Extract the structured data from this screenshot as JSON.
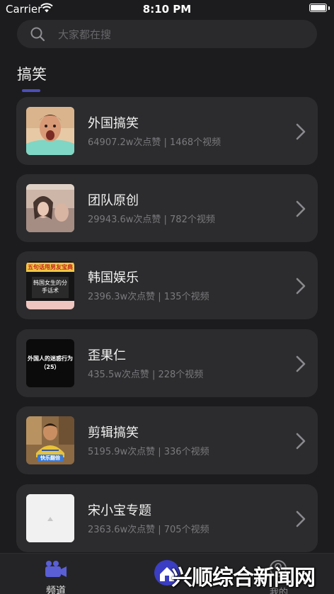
{
  "status": {
    "carrier": "Carrier",
    "time": "8:10 PM"
  },
  "search": {
    "placeholder": "大家都在搜"
  },
  "section": {
    "title": "搞笑"
  },
  "items": [
    {
      "title": "外国搞笑",
      "meta": "64907.2w次点赞 | 1468个视频"
    },
    {
      "title": "团队原创",
      "meta": "29943.6w次点赞 | 782个视频"
    },
    {
      "title": "韩国娱乐",
      "meta": "2396.3w次点赞 | 135个视频",
      "thumb_banner": "五句话甩男友宝典",
      "thumb_caption": "韩国女生的分手话术"
    },
    {
      "title": "歪果仁",
      "meta": "435.5w次点赞 | 228个视频",
      "thumb_caption": "外国人的迷惑行为（25）"
    },
    {
      "title": "剪辑搞笑",
      "meta": "5195.9w次点赞 | 336个视频",
      "thumb_caption": "快乐翻倍"
    },
    {
      "title": "宋小宝专题",
      "meta": "2363.6w次点赞 | 705个视频"
    }
  ],
  "tabs": {
    "channels": "频道",
    "mine": "我的"
  },
  "watermark": {
    "text": "兴顺综合新闻网"
  },
  "colors": {
    "background": "#1c1c1e",
    "card": "#2c2c2e",
    "accent": "#4b4eb8",
    "tab_icon": "#5a5fd6"
  },
  "icons": {
    "search": "search-icon",
    "chevron": "chevron-right-icon",
    "channels": "video-camera-icon",
    "mine": "user-icon"
  }
}
